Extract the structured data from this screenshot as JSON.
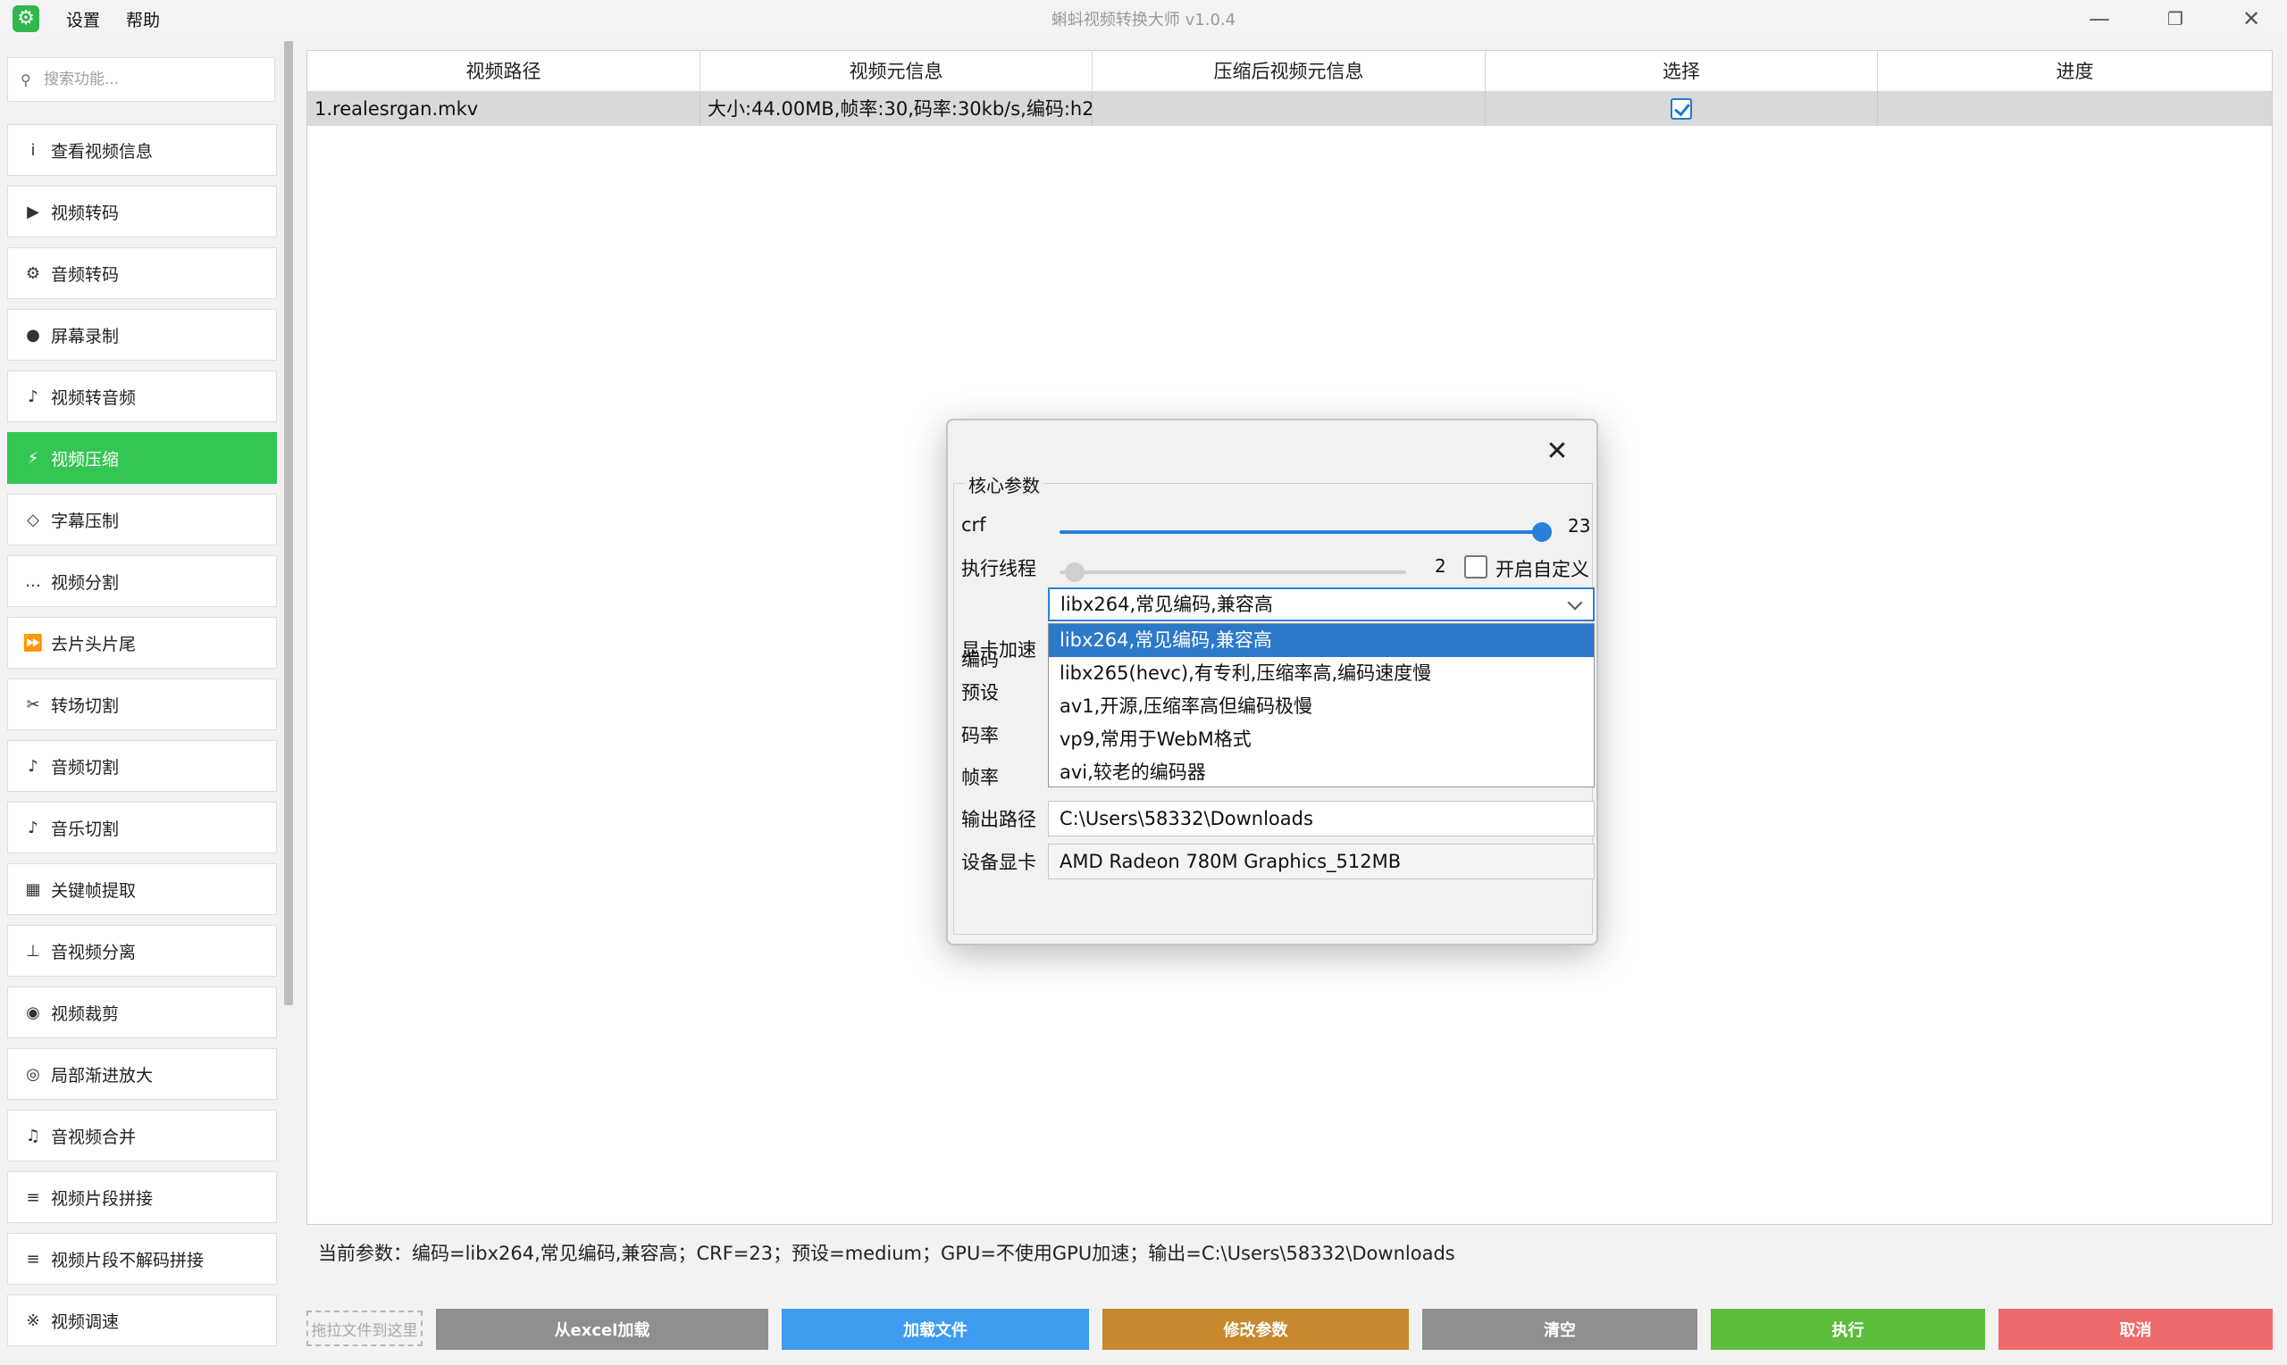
{
  "app": {
    "title": "蝌蚪视频转换大师 v1.0.4",
    "icon": "gear-icon",
    "menu": [
      "设置",
      "帮助"
    ]
  },
  "window_controls": {
    "minimize": "—",
    "restore": "❐",
    "close": "✕"
  },
  "sidebar": {
    "search_placeholder": "搜索功能...",
    "active_color": "#33c653",
    "items": [
      {
        "label": "查看视频信息",
        "icon": "info-icon",
        "glyph": "i"
      },
      {
        "label": "视频转码",
        "icon": "play-icon",
        "glyph": "▶"
      },
      {
        "label": "音频转码",
        "icon": "gear-icon",
        "glyph": "⚙"
      },
      {
        "label": "屏幕录制",
        "icon": "record-icon",
        "glyph": "●"
      },
      {
        "label": "视频转音频",
        "icon": "music-note-icon",
        "glyph": "♪"
      },
      {
        "label": "视频压缩",
        "icon": "lightning-icon",
        "glyph": "⚡",
        "active": true
      },
      {
        "label": "字幕压制",
        "icon": "diamond-icon",
        "glyph": "◇"
      },
      {
        "label": "视频分割",
        "icon": "ellipsis-icon",
        "glyph": "…"
      },
      {
        "label": "去片头片尾",
        "icon": "fast-forward-icon",
        "glyph": "⏩"
      },
      {
        "label": "转场切割",
        "icon": "scissors-icon",
        "glyph": "✂"
      },
      {
        "label": "音频切割",
        "icon": "music-note-icon",
        "glyph": "♪"
      },
      {
        "label": "音乐切割",
        "icon": "music-note-icon",
        "glyph": "♪"
      },
      {
        "label": "关键帧提取",
        "icon": "grid-icon",
        "glyph": "▦"
      },
      {
        "label": "音视频分离",
        "icon": "split-icon",
        "glyph": "⊥"
      },
      {
        "label": "视频裁剪",
        "icon": "target-icon",
        "glyph": "◉"
      },
      {
        "label": "局部渐进放大",
        "icon": "zoom-icon",
        "glyph": "◎"
      },
      {
        "label": "音视频合并",
        "icon": "music-notes-icon",
        "glyph": "♫"
      },
      {
        "label": "视频片段拼接",
        "icon": "list-icon",
        "glyph": "≡"
      },
      {
        "label": "视频片段不解码拼接",
        "icon": "list-icon",
        "glyph": "≡"
      },
      {
        "label": "视频调速",
        "icon": "speed-icon",
        "glyph": "※"
      }
    ]
  },
  "table": {
    "columns": [
      "视频路径",
      "视频元信息",
      "压缩后视频元信息",
      "选择",
      "进度"
    ],
    "rows": [
      {
        "path": "1.realesrgan.mkv",
        "meta": "大小:44.00MB,帧率:30,码率:30kb/s,编码:h2...",
        "compressed_meta": "",
        "selected": true,
        "progress": ""
      }
    ]
  },
  "status": {
    "text": "当前参数：编码=libx264,常见编码,兼容高；CRF=23；预设=medium；GPU=不使用GPU加速；输出=C:\\Users\\58332\\Downloads"
  },
  "bottom": {
    "drop_hint": "拖拉文件到这里",
    "buttons": [
      {
        "label": "从excel加载",
        "color": "#8f8f8f"
      },
      {
        "label": "加载文件",
        "color": "#3d9bf0"
      },
      {
        "label": "修改参数",
        "color": "#c8892e"
      },
      {
        "label": "清空",
        "color": "#8f8f8f"
      },
      {
        "label": "执行",
        "color": "#5cbe3c"
      },
      {
        "label": "取消",
        "color": "#ef6b6b"
      }
    ]
  },
  "dialog": {
    "close": "✕",
    "group_title": "核心参数",
    "crf": {
      "label": "crf",
      "value": "23",
      "min": 0,
      "max": 23
    },
    "threads": {
      "label": "执行线程",
      "value": "2",
      "custom_label": "开启自定义",
      "custom_checked": false
    },
    "codec": {
      "label": "编码",
      "selected": "libx264,常见编码,兼容高",
      "options": [
        "libx264,常见编码,兼容高",
        "libx265(hevc),有专利,压缩率高,编码速度慢",
        "av1,开源,压缩率高但编码极慢",
        "vp9,常用于WebM格式",
        "avi,较老的编码器"
      ]
    },
    "gpu_label": "显卡加速",
    "preset_label": "预设",
    "bitrate_label": "码率",
    "framerate_label": "帧率",
    "output": {
      "label": "输出路径",
      "value": "C:\\Users\\58332\\Downloads"
    },
    "device": {
      "label": "设备显卡",
      "value": "AMD Radeon 780M Graphics_512MB"
    }
  }
}
